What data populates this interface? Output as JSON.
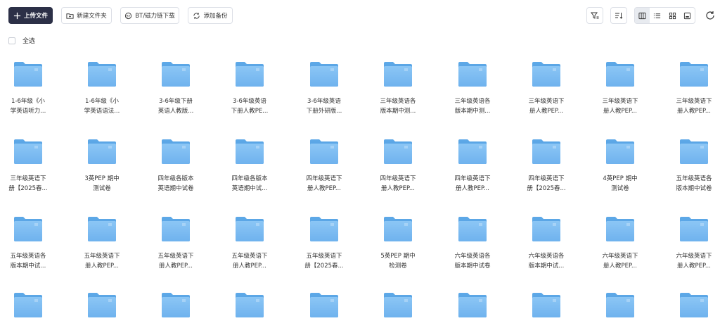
{
  "toolbar": {
    "upload_label": "上传文件",
    "new_folder_label": "新建文件夹",
    "bt_label": "BT/磁力链下载",
    "backup_label": "添加备份"
  },
  "select_all_label": "全选",
  "view_modes": [
    "column-view",
    "list-view",
    "grid-view",
    "preview-view"
  ],
  "active_view": "column-view",
  "folders": [
    [
      "1-6年级《小",
      "学英语听力..."
    ],
    [
      "1-6年级《小",
      "学英语语法..."
    ],
    [
      "3-6年级下册",
      "英语人教版..."
    ],
    [
      "3-6年级英语",
      "下册人教PE..."
    ],
    [
      "3-6年级英语",
      "下册外研版..."
    ],
    [
      "三年级英语各",
      "版本期中测..."
    ],
    [
      "三年级英语各",
      "版本期中测..."
    ],
    [
      "三年级英语下",
      "册人教PEP..."
    ],
    [
      "三年级英语下",
      "册人教PEP..."
    ],
    [
      "三年级英语下",
      "册人教PEP..."
    ],
    [
      "三年级英语下",
      "册【2025春..."
    ],
    [
      "3英PEP 期中",
      "测试卷"
    ],
    [
      "四年级各版本",
      "英语期中试卷"
    ],
    [
      "四年级各版本",
      "英语期中试..."
    ],
    [
      "四年级英语下",
      "册人教PEP..."
    ],
    [
      "四年级英语下",
      "册人教PEP..."
    ],
    [
      "四年级英语下",
      "册人教PEP..."
    ],
    [
      "四年级英语下",
      "册【2025春..."
    ],
    [
      "4英PEP 期中",
      "测试卷"
    ],
    [
      "五年级英语各",
      "版本期中试卷"
    ],
    [
      "五年级英语各",
      "版本期中试..."
    ],
    [
      "五年级英语下",
      "册人教PEP..."
    ],
    [
      "五年级英语下",
      "册人教PEP..."
    ],
    [
      "五年级英语下",
      "册人教PEP..."
    ],
    [
      "五年级英语下",
      "册【2025春..."
    ],
    [
      "5英PEP 期中",
      "检测卷"
    ],
    [
      "六年级英语各",
      "版本期中试卷"
    ],
    [
      "六年级英语各",
      "版本期中试..."
    ],
    [
      "六年级英语下",
      "册人教PEP..."
    ],
    [
      "六年级英语下",
      "册人教PEP..."
    ],
    [
      "",
      ""
    ],
    [
      "",
      ""
    ],
    [
      "",
      ""
    ],
    [
      "",
      ""
    ],
    [
      "",
      ""
    ],
    [
      "",
      ""
    ],
    [
      "",
      ""
    ],
    [
      "",
      ""
    ],
    [
      "",
      ""
    ],
    [
      "",
      ""
    ]
  ]
}
